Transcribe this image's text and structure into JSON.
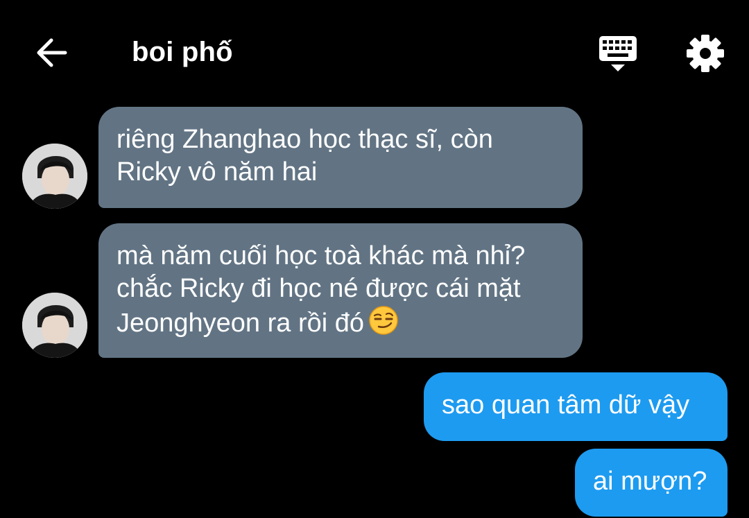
{
  "header": {
    "title": "boi phố",
    "back_icon": "arrow-left-icon",
    "keyboard_icon": "keyboard-icon",
    "settings_icon": "gear-icon"
  },
  "messages": [
    {
      "direction": "incoming",
      "lines": [
        "riêng Zhanghao học thạc sĩ, còn",
        "Ricky vô năm hai"
      ]
    },
    {
      "direction": "incoming",
      "lines": [
        "mà năm cuối học toà khác mà nhỉ?",
        "chắc Ricky đi học né được cái mặt",
        "Jeonghyeon ra rồi đó"
      ],
      "emoji": "smirking-face-emoji"
    },
    {
      "direction": "outgoing",
      "lines": [
        "sao quan tâm dữ vậy"
      ]
    },
    {
      "direction": "outgoing",
      "lines": [
        "ai mượn?"
      ]
    }
  ],
  "colors": {
    "background": "#000000",
    "incoming_bubble": "#627484",
    "outgoing_bubble": "#1d9bf0",
    "text": "#ffffff"
  }
}
